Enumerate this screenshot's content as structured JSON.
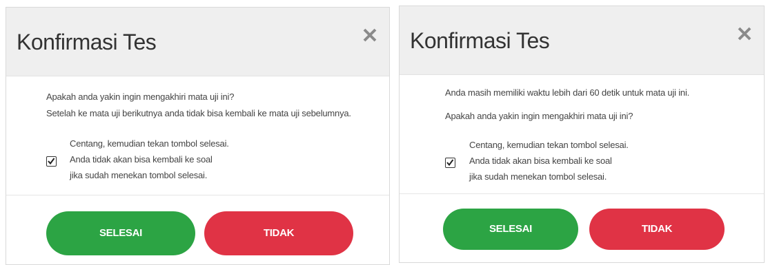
{
  "colors": {
    "header_bg": "#efefef",
    "selesai_button": "#2ca444",
    "tidak_button": "#e03345",
    "text": "#444444",
    "close_icon": "#8a8a8a"
  },
  "left_dialog": {
    "title": "Konfirmasi Tes",
    "close_icon": "close-icon",
    "messages": [
      "Apakah anda yakin ingin mengakhiri mata uji ini?",
      "Setelah ke mata uji berikutnya anda tidak bisa kembali ke mata uji sebelumnya."
    ],
    "checkbox_checked": true,
    "instructions": [
      "Centang, kemudian tekan tombol selesai.",
      "Anda tidak akan bisa kembali ke soal",
      "jika sudah menekan tombol selesai."
    ],
    "finish_label": "SELESAI",
    "cancel_label": "TIDAK"
  },
  "right_dialog": {
    "title": "Konfirmasi Tes",
    "close_icon": "close-icon",
    "messages": [
      "Anda masih memiliki waktu lebih dari 60 detik untuk mata uji ini.",
      "Apakah anda yakin ingin mengakhiri mata uji ini?"
    ],
    "checkbox_checked": true,
    "instructions": [
      "Centang, kemudian tekan tombol selesai.",
      "Anda tidak akan bisa kembali ke soal",
      "jika sudah menekan tombol selesai."
    ],
    "finish_label": "SELESAI",
    "cancel_label": "TIDAK"
  }
}
